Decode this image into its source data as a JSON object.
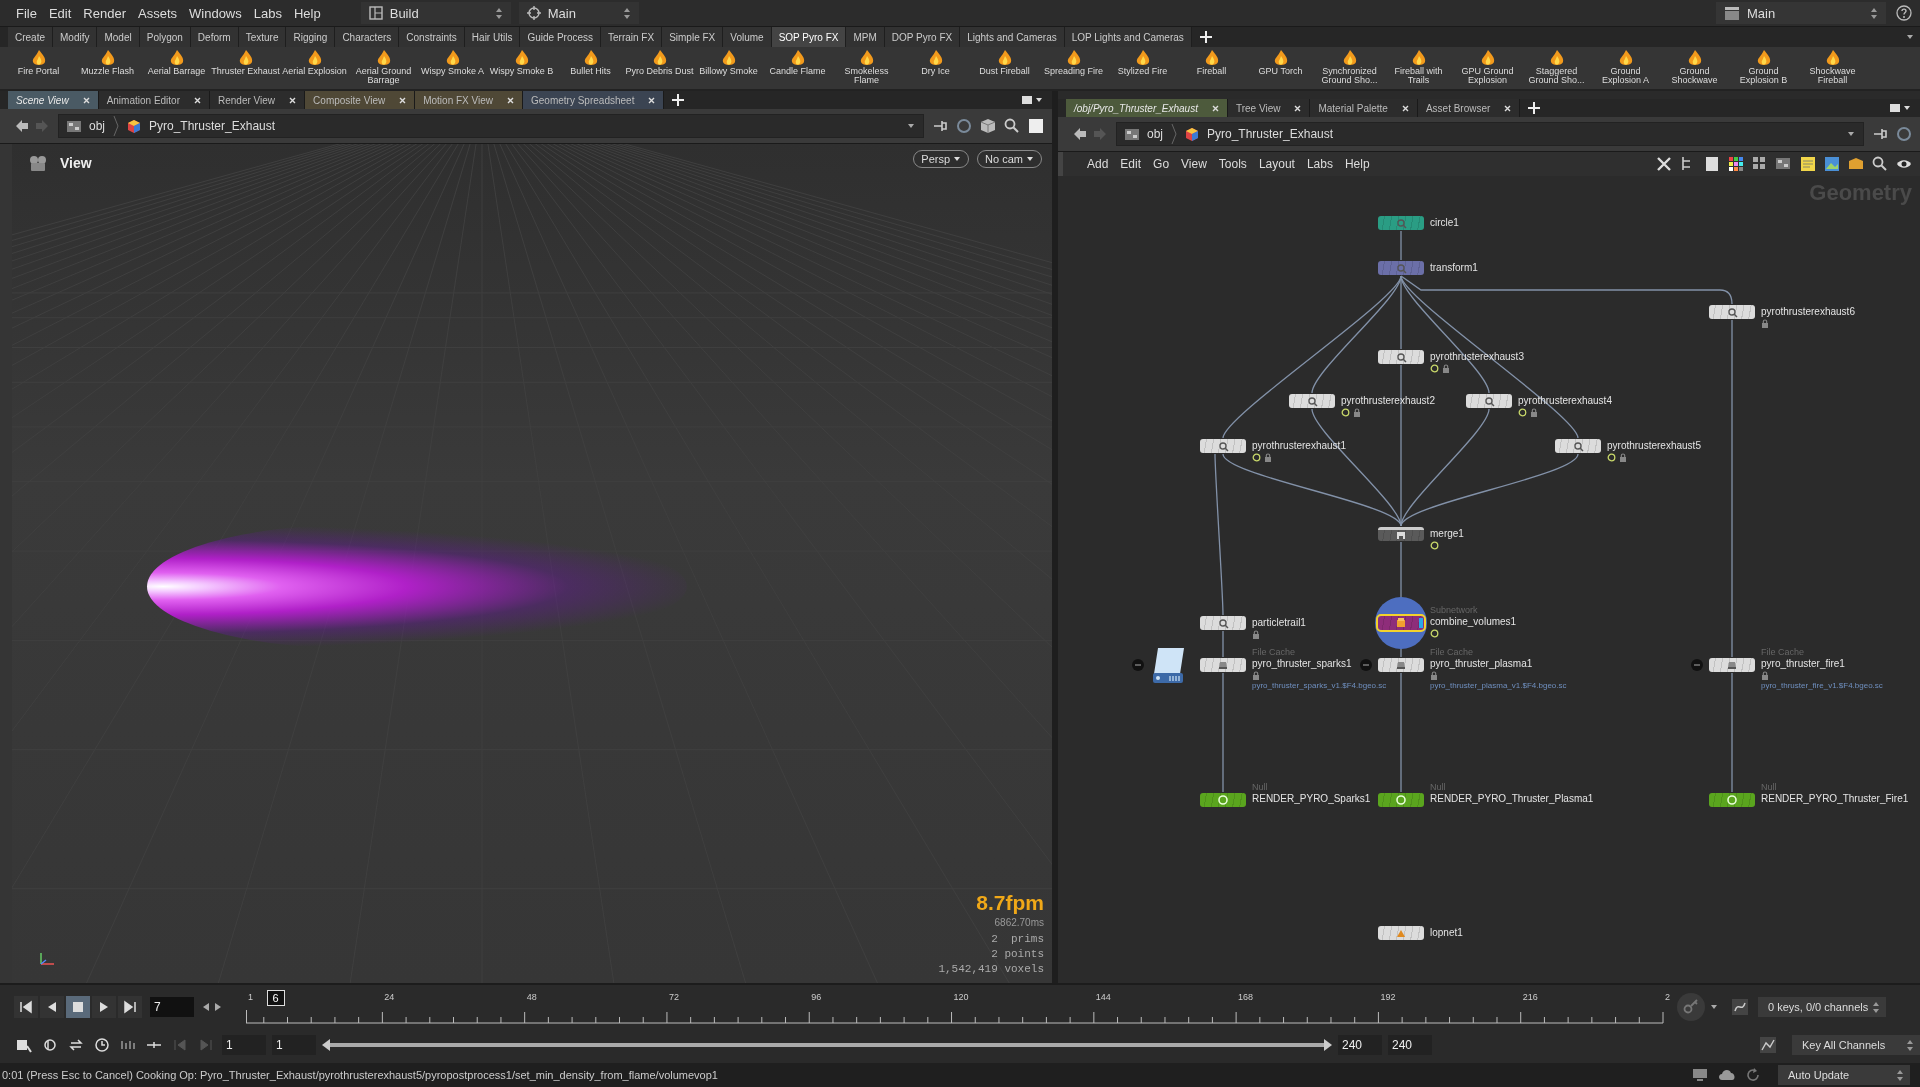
{
  "menu_bar": {
    "items": [
      "File",
      "Edit",
      "Render",
      "Assets",
      "Windows",
      "Labs",
      "Help"
    ],
    "desktop": "Build",
    "context": "Main",
    "right_context": "Main"
  },
  "shelf": {
    "tabs": [
      {
        "label": "Create",
        "selected": false
      },
      {
        "label": "Modify",
        "selected": false
      },
      {
        "label": "Model",
        "selected": false
      },
      {
        "label": "Polygon",
        "selected": false
      },
      {
        "label": "Deform",
        "selected": false
      },
      {
        "label": "Texture",
        "selected": false
      },
      {
        "label": "Rigging",
        "selected": false
      },
      {
        "label": "Characters",
        "selected": false
      },
      {
        "label": "Constraints",
        "selected": false
      },
      {
        "label": "Hair Utils",
        "selected": false
      },
      {
        "label": "Guide Process",
        "selected": false
      },
      {
        "label": "Terrain FX",
        "selected": false
      },
      {
        "label": "Simple FX",
        "selected": false
      },
      {
        "label": "Volume",
        "selected": false
      },
      {
        "label": "SOP Pyro FX",
        "selected": true
      },
      {
        "label": "MPM",
        "selected": false
      },
      {
        "label": "DOP Pyro FX",
        "selected": false
      },
      {
        "label": "Lights and Cameras",
        "selected": false
      },
      {
        "label": "LOP Lights and Cameras",
        "selected": false
      }
    ],
    "tools": [
      "Fire Portal",
      "Muzzle Flash",
      "Aerial Barrage",
      "Thruster Exhaust",
      "Aerial Explosion",
      "Aerial Ground Barrage",
      "Wispy Smoke A",
      "Wispy Smoke B",
      "Bullet Hits",
      "Pyro Debris Dust",
      "Billowy Smoke",
      "Candle Flame",
      "Smokeless Flame",
      "Dry Ice",
      "Dust Fireball",
      "Spreading Fire",
      "Stylized Fire",
      "Fireball",
      "GPU Torch",
      "Synchronized Ground Sho...",
      "Fireball with Trails",
      "GPU Ground Explosion",
      "Staggered Ground Sho...",
      "Ground Explosion A",
      "Ground Shockwave",
      "Ground Explosion B",
      "Shockwave Fireball"
    ]
  },
  "scene_view": {
    "tabs": [
      {
        "label": "Scene View",
        "selected": true,
        "color": "#4a5a64"
      },
      {
        "label": "Animation Editor",
        "selected": false,
        "color": "#2c2c2c"
      },
      {
        "label": "Render View",
        "selected": false,
        "color": "#2c2c2c"
      },
      {
        "label": "Composite View",
        "selected": false,
        "color": "#4f4836"
      },
      {
        "label": "Motion FX View",
        "selected": false,
        "color": "#4f4836"
      },
      {
        "label": "Geometry Spreadsheet",
        "selected": false,
        "color": "#3b4452"
      }
    ],
    "path": [
      "obj",
      "Pyro_Thruster_Exhaust"
    ],
    "title": "View",
    "camera_buttons": [
      "Persp",
      "No cam"
    ],
    "stats": {
      "fps": "8.7fpm",
      "time": "6862.70ms",
      "lines": [
        "2  prims",
        "2 points",
        "1,542,419 voxels"
      ]
    }
  },
  "network_view": {
    "tabs": [
      {
        "label": "/obj/Pyro_Thruster_Exhaust",
        "selected": true,
        "color": "#4d5a3c"
      },
      {
        "label": "Tree View",
        "selected": false,
        "color": "#2c2c2c"
      },
      {
        "label": "Material Palette",
        "selected": false,
        "color": "#2c2c2c"
      },
      {
        "label": "Asset Browser",
        "selected": false,
        "color": "#2c2c2c"
      }
    ],
    "path": [
      "obj",
      "Pyro_Thruster_Exhaust"
    ],
    "menu": [
      "Add",
      "Edit",
      "Go",
      "View",
      "Tools",
      "Layout",
      "Labs",
      "Help"
    ],
    "context_label": "Geometry",
    "nodes": [
      {
        "name": "circle1",
        "kind": "sop",
        "color": "#2a9d84",
        "display_flag": false,
        "locked": false,
        "current": false,
        "cache_badge": false
      },
      {
        "name": "transform1",
        "kind": "sop",
        "color": "#6b6fa8",
        "display_flag": false,
        "locked": false,
        "current": false,
        "cache_badge": false
      },
      {
        "name": "pyrothrusterexhaust6",
        "kind": "sop",
        "color": "#dcdcdc",
        "display_flag": false,
        "locked": true,
        "current": false,
        "cache_badge": false
      },
      {
        "name": "pyrothrusterexhaust3",
        "kind": "sop",
        "color": "#dcdcdc",
        "display_flag": true,
        "locked": true,
        "current": false,
        "cache_badge": false
      },
      {
        "name": "pyrothrusterexhaust2",
        "kind": "sop",
        "color": "#dcdcdc",
        "display_flag": true,
        "locked": true,
        "current": false,
        "cache_badge": false
      },
      {
        "name": "pyrothrusterexhaust4",
        "kind": "sop",
        "color": "#dcdcdc",
        "display_flag": true,
        "locked": true,
        "current": false,
        "cache_badge": false
      },
      {
        "name": "pyrothrusterexhaust1",
        "kind": "sop",
        "color": "#dcdcdc",
        "display_flag": true,
        "locked": true,
        "current": false,
        "cache_badge": false
      },
      {
        "name": "pyrothrusterexhaust5",
        "kind": "sop",
        "color": "#dcdcdc",
        "display_flag": true,
        "locked": true,
        "current": false,
        "cache_badge": false
      },
      {
        "name": "merge1",
        "kind": "merge",
        "color": "#5a5a5a",
        "display_flag": true,
        "locked": false,
        "current": false,
        "cache_badge": false
      },
      {
        "name": "particletrail1",
        "kind": "sop",
        "color": "#dcdcdc",
        "display_flag": false,
        "locked": true,
        "current": false,
        "cache_badge": false
      },
      {
        "name": "combine_volumes1",
        "type_label": "Subnetwork",
        "kind": "subnet",
        "color": "#8e2d7a",
        "display_flag": true,
        "locked": false,
        "current": true,
        "cache_badge": false
      },
      {
        "name": "pyro_thruster_sparks1",
        "type_label": "File Cache",
        "file": "pyro_thruster_sparks_v1.$F4.bgeo.sc",
        "kind": "file_cache",
        "color": "#dcdcdc",
        "display_flag": false,
        "locked": true,
        "current": false,
        "cache_badge": true
      },
      {
        "name": "pyro_thruster_plasma1",
        "type_label": "File Cache",
        "file": "pyro_thruster_plasma_v1.$F4.bgeo.sc",
        "kind": "file_cache",
        "color": "#dcdcdc",
        "display_flag": false,
        "locked": true,
        "current": false,
        "cache_badge": false
      },
      {
        "name": "pyro_thruster_fire1",
        "type_label": "File Cache",
        "file": "pyro_thruster_fire_v1.$F4.bgeo.sc",
        "kind": "file_cache",
        "color": "#dcdcdc",
        "display_flag": false,
        "locked": true,
        "current": false,
        "cache_badge": false
      },
      {
        "name": "RENDER_PYRO_Sparks1",
        "type_label": "Null",
        "kind": "null",
        "color": "#5aa51e",
        "display_flag": false,
        "locked": false,
        "current": false,
        "cache_badge": false
      },
      {
        "name": "RENDER_PYRO_Thruster_Plasma1",
        "type_label": "Null",
        "kind": "null",
        "color": "#5aa51e",
        "display_flag": false,
        "locked": false,
        "current": false,
        "cache_badge": false
      },
      {
        "name": "RENDER_PYRO_Thruster_Fire1",
        "type_label": "Null",
        "kind": "null",
        "color": "#5aa51e",
        "display_flag": false,
        "locked": false,
        "current": false,
        "cache_badge": false
      },
      {
        "name": "lopnet1",
        "kind": "lop",
        "color": "#dcdcdc",
        "display_flag": false,
        "locked": false,
        "current": false,
        "cache_badge": false
      }
    ]
  },
  "timeline": {
    "current_frame": "7",
    "marker": "6",
    "ruler_labels": [
      "1",
      "24",
      "48",
      "72",
      "96",
      "120",
      "144",
      "168",
      "192",
      "216",
      "2"
    ],
    "start": "1",
    "range_start": "1",
    "range_bar": {
      "level": 1
    },
    "range_end": "240",
    "end": "240",
    "keys": "0 keys, 0/0 channels",
    "key_mode": "Key All Channels"
  },
  "status_bar": {
    "message": "0:01 (Press Esc to Cancel) Cooking Op: Pyro_Thruster_Exhaust/pyrothrusterexhaust5/pyropostprocess1/set_min_density_from_flame/volumevop1",
    "update_mode": "Auto Update"
  }
}
